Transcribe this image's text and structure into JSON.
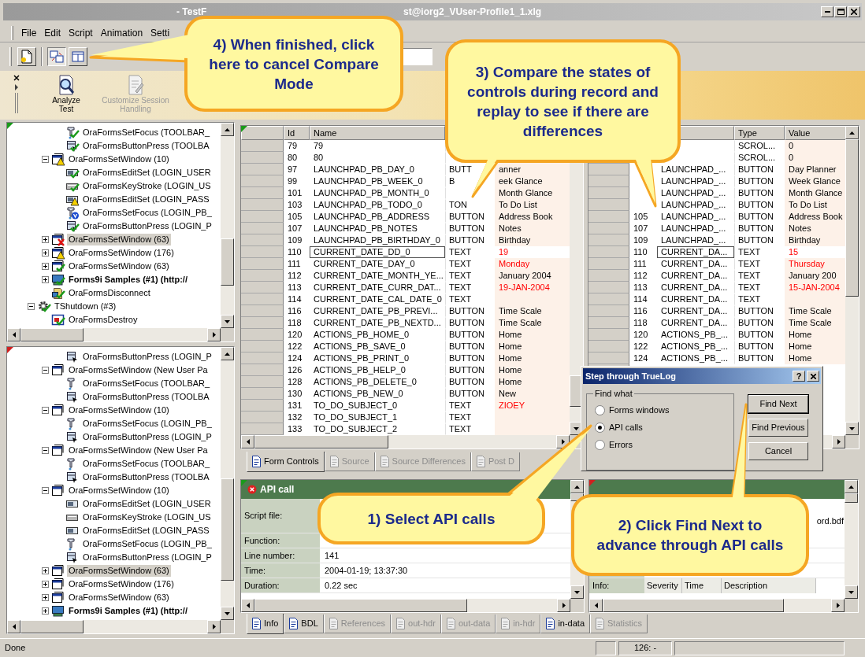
{
  "window": {
    "title_parts": [
      "- TestF",
      "st@iorg2_VUser-Profile1_1.xlg"
    ]
  },
  "menu": [
    "File",
    "Edit",
    "Script",
    "Animation",
    "Setti"
  ],
  "ribbon": [
    {
      "label": "Analyze Test",
      "disabled": false
    },
    {
      "label": "Customize Session Handling",
      "disabled": true
    }
  ],
  "top_tree": [
    {
      "children": [
        {
          "children": [
            {
              "label": "OraFormsSetFocus (TOOLBAR_",
              "kind": "focus",
              "passed": true,
              "warning": false,
              "failed": false,
              "verified": false,
              "selected": false
            },
            {
              "label": "OraFormsButtonPress (TOOLBA",
              "kind": "press",
              "passed": true,
              "warning": false,
              "failed": false,
              "verified": false,
              "selected": false
            }
          ]
        },
        {
          "label": "OraFormsSetWindow (10)",
          "kind": "window",
          "passed": false,
          "warning": true,
          "failed": false,
          "verified": false,
          "expanded": true,
          "selected": false,
          "children": [
            {
              "label": "OraFormsEditSet (LOGIN_USER",
              "kind": "edit",
              "passed": true,
              "warning": false,
              "failed": false,
              "verified": false,
              "selected": false
            },
            {
              "label": "OraFormsKeyStroke (LOGIN_US",
              "kind": "keystroke",
              "passed": true,
              "warning": false,
              "failed": false,
              "verified": false,
              "selected": false
            },
            {
              "label": "OraFormsEditSet (LOGIN_PASS",
              "kind": "edit",
              "passed": false,
              "warning": true,
              "failed": false,
              "verified": false,
              "selected": false
            },
            {
              "label": "OraFormsSetFocus (LOGIN_PB_",
              "kind": "focus",
              "passed": false,
              "warning": false,
              "failed": false,
              "verified": true,
              "selected": false
            },
            {
              "label": "OraFormsButtonPress (LOGIN_P",
              "kind": "press",
              "passed": true,
              "warning": false,
              "failed": false,
              "verified": false,
              "selected": false
            }
          ]
        },
        {
          "label": "OraFormsSetWindow (63)",
          "kind": "window",
          "passed": false,
          "warning": false,
          "failed": true,
          "verified": false,
          "expanded": false,
          "selected": true
        },
        {
          "label": "OraFormsSetWindow (176)",
          "kind": "window",
          "passed": false,
          "warning": true,
          "failed": false,
          "verified": false,
          "expanded": false,
          "selected": false
        },
        {
          "label": "OraFormsSetWindow (63)",
          "kind": "window",
          "passed": true,
          "warning": false,
          "failed": false,
          "verified": false,
          "expanded": false,
          "selected": false
        },
        {
          "label": "Forms9i Samples (#1) (http://",
          "kind": "app",
          "passed": true,
          "warning": false,
          "failed": false,
          "verified": false,
          "expanded": false,
          "selected": false
        },
        {
          "label": "OraFormsDisconnect",
          "kind": "disconnect",
          "passed": true,
          "warning": false,
          "failed": false,
          "verified": false,
          "selected": false
        }
      ]
    },
    {
      "label": "TShutdown (#3)",
      "kind": "shutdown",
      "passed": true,
      "warning": false,
      "failed": false,
      "verified": false,
      "expanded": true,
      "selected": false,
      "children": [
        {
          "label": "OraFormsDestroy",
          "kind": "destroy",
          "passed": true,
          "warning": false,
          "failed": false,
          "verified": false,
          "selected": false
        }
      ]
    }
  ],
  "bottom_tree": [
    {
      "children": [
        {
          "children": [
            {
              "label": "OraFormsButtonPress (LOGIN_P",
              "kind": "press",
              "selected": false
            }
          ]
        },
        {
          "label": "OraFormsSetWindow (New User Pa",
          "kind": "window",
          "expanded": true,
          "selected": false,
          "children": [
            {
              "label": "OraFormsSetFocus (TOOLBAR_",
              "kind": "focus",
              "selected": false
            },
            {
              "label": "OraFormsButtonPress (TOOLBA",
              "kind": "press",
              "selected": false
            }
          ]
        },
        {
          "label": "OraFormsSetWindow (10)",
          "kind": "window",
          "expanded": true,
          "selected": false,
          "children": [
            {
              "label": "OraFormsSetFocus (LOGIN_PB_",
              "kind": "focus",
              "selected": false
            },
            {
              "label": "OraFormsButtonPress (LOGIN_P",
              "kind": "press",
              "selected": false
            }
          ]
        },
        {
          "label": "OraFormsSetWindow (New User Pa",
          "kind": "window",
          "expanded": true,
          "selected": false,
          "children": [
            {
              "label": "OraFormsSetFocus (TOOLBAR_",
              "kind": "focus",
              "selected": false
            },
            {
              "label": "OraFormsButtonPress (TOOLBA",
              "kind": "press",
              "selected": false
            }
          ]
        },
        {
          "label": "OraFormsSetWindow (10)",
          "kind": "window",
          "expanded": true,
          "selected": false,
          "children": [
            {
              "label": "OraFormsEditSet (LOGIN_USER",
              "kind": "edit",
              "selected": false
            },
            {
              "label": "OraFormsKeyStroke (LOGIN_US",
              "kind": "keystroke",
              "selected": false
            },
            {
              "label": "OraFormsEditSet (LOGIN_PASS",
              "kind": "edit",
              "selected": false
            },
            {
              "label": "OraFormsSetFocus (LOGIN_PB_",
              "kind": "focus",
              "selected": false
            },
            {
              "label": "OraFormsButtonPress (LOGIN_P",
              "kind": "press",
              "selected": false
            }
          ]
        },
        {
          "label": "OraFormsSetWindow (63)",
          "kind": "window",
          "expanded": false,
          "selected": true
        },
        {
          "label": "OraFormsSetWindow (176)",
          "kind": "window",
          "expanded": false,
          "selected": false
        },
        {
          "label": "OraFormsSetWindow (63)",
          "kind": "window",
          "expanded": false,
          "selected": false
        },
        {
          "label": "Forms9i Samples (#1) (http://",
          "kind": "app",
          "expanded": false,
          "selected": false
        }
      ]
    }
  ],
  "middle_table": {
    "columns": [
      "Id",
      "Name"
    ],
    "rows": [
      {
        "id": "79",
        "name": "79",
        "selected": false
      },
      {
        "id": "80",
        "name": "80",
        "selected": false
      },
      {
        "id": "97",
        "name": "LAUNCHPAD_PB_DAY_0",
        "type": "BUTT",
        "value": "anner",
        "selected": false,
        "changed": false
      },
      {
        "id": "99",
        "name": "LAUNCHPAD_PB_WEEK_0",
        "type": "B",
        "value": "eek Glance",
        "selected": false,
        "changed": false
      },
      {
        "id": "101",
        "name": "LAUNCHPAD_PB_MONTH_0",
        "value": "Month Glance",
        "selected": false,
        "changed": false
      },
      {
        "id": "103",
        "name": "LAUNCHPAD_PB_TODO_0",
        "type": "TON",
        "value": "To Do List",
        "selected": false,
        "changed": false
      },
      {
        "id": "105",
        "name": "LAUNCHPAD_PB_ADDRESS",
        "type": "BUTTON",
        "value": "Address Book",
        "selected": false,
        "changed": false
      },
      {
        "id": "107",
        "name": "LAUNCHPAD_PB_NOTES",
        "type": "BUTTON",
        "value": "Notes",
        "selected": false,
        "changed": false
      },
      {
        "id": "109",
        "name": "LAUNCHPAD_PB_BIRTHDAY_0",
        "type": "BUTTON",
        "value": "Birthday",
        "selected": false,
        "changed": false
      },
      {
        "id": "110",
        "name": "CURRENT_DATE_DD_0",
        "type": "TEXT",
        "value": "19",
        "selected": true,
        "changed": true
      },
      {
        "id": "111",
        "name": "CURRENT_DATE_DAY_0",
        "type": "TEXT",
        "value": "Monday",
        "selected": false,
        "changed": true
      },
      {
        "id": "112",
        "name": "CURRENT_DATE_MONTH_YE...",
        "type": "TEXT",
        "value": "January   2004",
        "selected": false,
        "changed": false
      },
      {
        "id": "113",
        "name": "CURRENT_DATE_CURR_DAT...",
        "type": "TEXT",
        "value": "19-JAN-2004",
        "selected": false,
        "changed": true
      },
      {
        "id": "114",
        "name": "CURRENT_DATE_CAL_DATE_0",
        "type": "TEXT",
        "selected": false
      },
      {
        "id": "116",
        "name": "CURRENT_DATE_PB_PREVI...",
        "type": "BUTTON",
        "value": "Time Scale",
        "selected": false,
        "changed": false
      },
      {
        "id": "118",
        "name": "CURRENT_DATE_PB_NEXTD...",
        "type": "BUTTON",
        "value": "Time Scale",
        "selected": false,
        "changed": false
      },
      {
        "id": "120",
        "name": "ACTIONS_PB_HOME_0",
        "type": "BUTTON",
        "value": "Home",
        "selected": false,
        "changed": false
      },
      {
        "id": "122",
        "name": "ACTIONS_PB_SAVE_0",
        "type": "BUTTON",
        "value": "Home",
        "selected": false,
        "changed": false
      },
      {
        "id": "124",
        "name": "ACTIONS_PB_PRINT_0",
        "type": "BUTTON",
        "value": "Home",
        "selected": false,
        "changed": false
      },
      {
        "id": "126",
        "name": "ACTIONS_PB_HELP_0",
        "type": "BUTTON",
        "value": "Home",
        "selected": false,
        "changed": false
      },
      {
        "id": "128",
        "name": "ACTIONS_PB_DELETE_0",
        "type": "BUTTON",
        "value": "Home",
        "selected": false,
        "changed": false
      },
      {
        "id": "130",
        "name": "ACTIONS_PB_NEW_0",
        "type": "BUTTON",
        "value": "New",
        "selected": false,
        "changed": false
      },
      {
        "id": "131",
        "name": "TO_DO_SUBJECT_0",
        "type": "TEXT",
        "value": "ZIOEY",
        "selected": false,
        "changed": true
      },
      {
        "id": "132",
        "name": "TO_DO_SUBJECT_1",
        "type": "TEXT",
        "selected": false
      },
      {
        "id": "133",
        "name": "TO_DO_SUBJECT_2",
        "type": "TEXT",
        "selected": false
      }
    ]
  },
  "right_table": {
    "columns": [
      "Type",
      "Value"
    ],
    "rows": [
      {
        "type": "SCROL...",
        "value": "0",
        "changed": false
      },
      {
        "type": "SCROL...",
        "value": "0",
        "changed": false
      },
      {
        "name": "LAUNCHPAD_...",
        "type": "BUTTON",
        "value": "Day Planner",
        "selected": false,
        "changed": false
      },
      {
        "name": "LAUNCHPAD_...",
        "type": "BUTTON",
        "value": "Week Glance",
        "selected": false,
        "changed": false
      },
      {
        "name": "LAUNCHPAD_...",
        "type": "BUTTON",
        "value": "Month Glance",
        "selected": false,
        "changed": false
      },
      {
        "name": "LAUNCHPAD_...",
        "type": "BUTTON",
        "value": "To Do List",
        "selected": false,
        "changed": false
      },
      {
        "id": "105",
        "name": "LAUNCHPAD_...",
        "type": "BUTTON",
        "value": "Address Book",
        "selected": false,
        "changed": false
      },
      {
        "id": "107",
        "name": "LAUNCHPAD_...",
        "type": "BUTTON",
        "value": "Notes",
        "selected": false,
        "changed": false
      },
      {
        "id": "109",
        "name": "LAUNCHPAD_...",
        "type": "BUTTON",
        "value": "Birthday",
        "selected": false,
        "changed": false
      },
      {
        "id": "110",
        "name": "CURRENT_DA...",
        "type": "TEXT",
        "value": "15",
        "selected": true,
        "changed": true
      },
      {
        "id": "111",
        "name": "CURRENT_DA...",
        "type": "TEXT",
        "value": "Thursday",
        "selected": false,
        "changed": true
      },
      {
        "id": "112",
        "name": "CURRENT_DA...",
        "type": "TEXT",
        "value": "January   200",
        "selected": false,
        "changed": false
      },
      {
        "id": "113",
        "name": "CURRENT_DA...",
        "type": "TEXT",
        "value": "15-JAN-2004",
        "selected": false,
        "changed": true
      },
      {
        "id": "114",
        "name": "CURRENT_DA...",
        "type": "TEXT",
        "selected": false
      },
      {
        "id": "116",
        "name": "CURRENT_DA...",
        "type": "BUTTON",
        "value": "Time Scale",
        "selected": false,
        "changed": false
      },
      {
        "id": "118",
        "name": "CURRENT_DA...",
        "type": "BUTTON",
        "value": "Time Scale",
        "selected": false,
        "changed": false
      },
      {
        "id": "120",
        "name": "ACTIONS_PB_...",
        "type": "BUTTON",
        "value": "Home",
        "selected": false,
        "changed": false
      },
      {
        "id": "122",
        "name": "ACTIONS_PB_...",
        "type": "BUTTON",
        "value": "Home",
        "selected": false,
        "changed": false
      },
      {
        "id": "124",
        "name": "ACTIONS_PB_...",
        "type": "BUTTON",
        "value": "Home",
        "selected": false,
        "changed": false
      }
    ]
  },
  "mid_tabs": [
    {
      "label": "Form Controls",
      "selected": true,
      "disabled": false
    },
    {
      "label": "Source",
      "selected": false,
      "disabled": true
    },
    {
      "label": "Source Differences",
      "selected": false,
      "disabled": true
    },
    {
      "label": "Post D",
      "selected": false,
      "disabled": true
    }
  ],
  "dialog": {
    "title": "Step through TrueLog",
    "help_button": "?",
    "group": "Find what",
    "options": [
      {
        "label": "Forms windows",
        "selected": false
      },
      {
        "label": "API calls",
        "selected": true
      },
      {
        "label": "Errors",
        "selected": false
      }
    ],
    "buttons": [
      {
        "label": "Find Next",
        "default": true
      },
      {
        "label": "Find Previous",
        "default": false
      },
      {
        "label": "Cancel",
        "default": false
      }
    ]
  },
  "api_panel": {
    "title": "API call",
    "rows": [
      {
        "label": "Script file:"
      },
      {
        "label": "Function:"
      },
      {
        "label": "Line number:",
        "value": "141"
      },
      {
        "label": "Time:",
        "value": "2004-01-19; 13:37:30"
      },
      {
        "label": "Duration:",
        "value": "0.22 sec"
      }
    ]
  },
  "info_panel": {
    "fragment": "ord.bdf",
    "info_label": "Info:",
    "info_columns": [
      "Severity",
      "Time",
      "Description"
    ]
  },
  "bottom_tabs": [
    {
      "label": "Info",
      "selected": true,
      "disabled": false
    },
    {
      "label": "BDL",
      "selected": false,
      "disabled": false
    },
    {
      "label": "References",
      "selected": false,
      "disabled": true
    },
    {
      "label": "out-hdr",
      "selected": false,
      "disabled": true
    },
    {
      "label": "out-data",
      "selected": false,
      "disabled": true
    },
    {
      "label": "in-hdr",
      "selected": false,
      "disabled": true
    },
    {
      "label": "in-data",
      "selected": false,
      "disabled": false
    },
    {
      "label": "Statistics",
      "selected": false,
      "disabled": true
    }
  ],
  "status_bar": {
    "text": "Done",
    "position": "126: -"
  },
  "callouts": [
    "4) When finished, click here to cancel Compare Mode",
    "3) Compare the states of controls during record and replay to see if there are differences",
    "1) Select API calls",
    "2) Click Find Next to advance through API calls"
  ]
}
